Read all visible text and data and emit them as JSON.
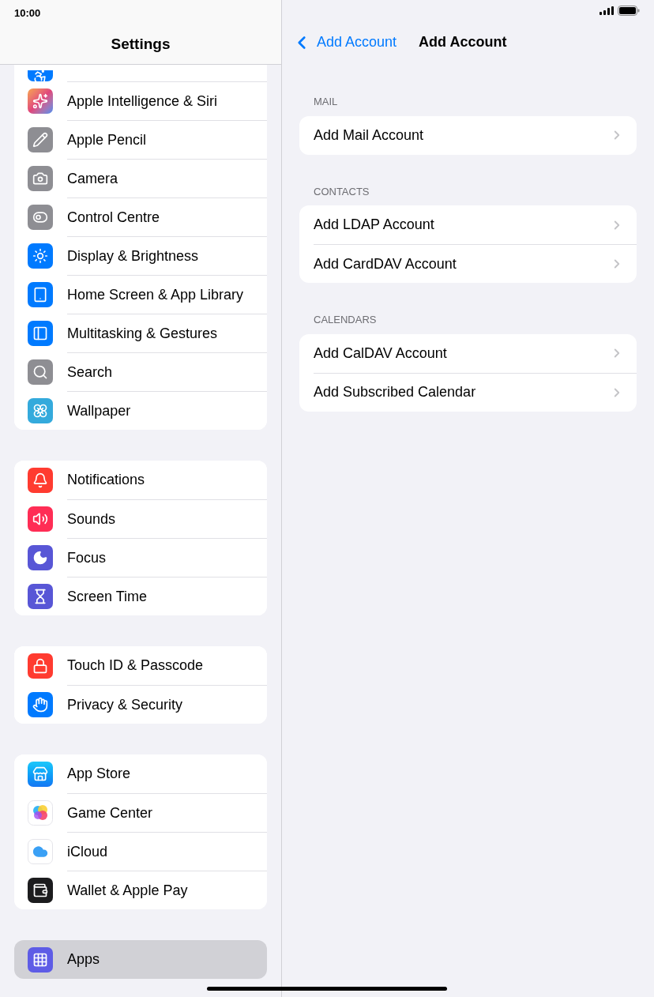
{
  "status_bar": {
    "time": "10:00"
  },
  "sidebar": {
    "title": "Settings",
    "groups": [
      {
        "items": [
          {
            "label": "Apple Intelligence & Siri",
            "selected": false
          },
          {
            "label": "Apple Pencil",
            "selected": false
          },
          {
            "label": "Camera",
            "selected": false
          },
          {
            "label": "Control Centre",
            "selected": false
          },
          {
            "label": "Display & Brightness",
            "selected": false
          },
          {
            "label": "Home Screen & App Library",
            "selected": false
          },
          {
            "label": "Multitasking & Gestures",
            "selected": false
          },
          {
            "label": "Search",
            "selected": false
          },
          {
            "label": "Wallpaper",
            "selected": false
          }
        ]
      },
      {
        "items": [
          {
            "label": "Notifications",
            "selected": false
          },
          {
            "label": "Sounds",
            "selected": false
          },
          {
            "label": "Focus",
            "selected": false
          },
          {
            "label": "Screen Time",
            "selected": false
          }
        ]
      },
      {
        "items": [
          {
            "label": "Touch ID & Passcode",
            "selected": false
          },
          {
            "label": "Privacy & Security",
            "selected": false
          }
        ]
      },
      {
        "items": [
          {
            "label": "App Store",
            "selected": false
          },
          {
            "label": "Game Center",
            "selected": false
          },
          {
            "label": "iCloud",
            "selected": false
          },
          {
            "label": "Wallet & Apple Pay",
            "selected": false
          }
        ]
      },
      {
        "items": [
          {
            "label": "Apps",
            "selected": true
          }
        ]
      }
    ]
  },
  "detail": {
    "back": "Add Account",
    "title": "Add Account",
    "sections": [
      {
        "header": "MAIL",
        "items": [
          "Add Mail Account"
        ]
      },
      {
        "header": "CONTACTS",
        "items": [
          "Add LDAP Account",
          "Add CardDAV Account"
        ]
      },
      {
        "header": "CALENDARS",
        "items": [
          "Add CalDAV Account",
          "Add Subscribed Calendar"
        ]
      }
    ]
  }
}
